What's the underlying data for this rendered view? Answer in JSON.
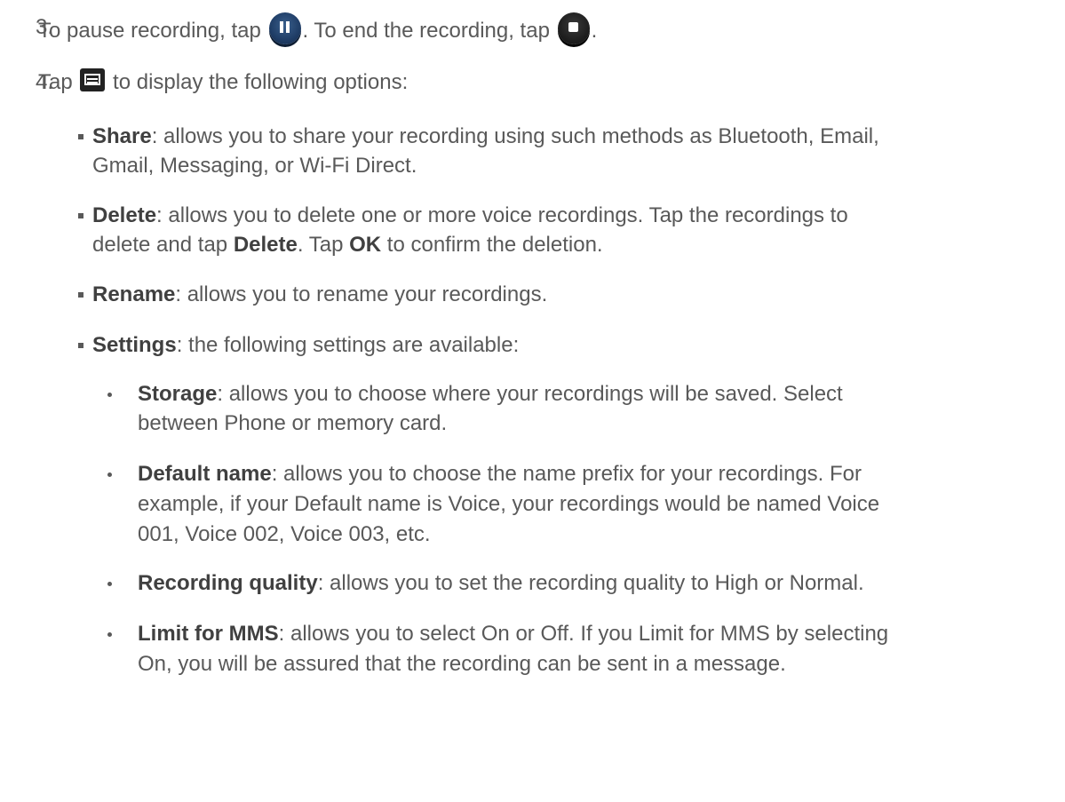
{
  "steps": [
    {
      "number": "3.",
      "t1": "To pause recording, tap",
      "t2": ". To end the recording, tap",
      "t3": ".",
      "icons": [
        "pause-icon",
        "stop-icon"
      ]
    },
    {
      "number": "4.",
      "t1": "Tap",
      "t2": "to display the following options:",
      "icons": [
        "menu-icon"
      ]
    }
  ],
  "options": [
    {
      "label": "Share",
      "line1": ": allows you to share your recording using such methods as Bluetooth, Email,",
      "line2": "Gmail, Messaging, or Wi-Fi Direct."
    },
    {
      "label": "Delete",
      "line1": ": allows you to delete one or more voice recordings. Tap the recordings to",
      "line2a": "delete and tap ",
      "line2b": "Delete",
      "line2c": ". Tap ",
      "line2d": "OK",
      "line2e": " to confirm the deletion."
    },
    {
      "label": "Rename",
      "line1": ": allows you to rename your recordings."
    },
    {
      "label": "Settings",
      "line1": ": the following settings are available:"
    }
  ],
  "settings": [
    {
      "label": "Storage",
      "line1": ": allows you to choose where your recordings will be saved. Select",
      "line2": "between Phone or memory card."
    },
    {
      "label": "Default name",
      "line1": ": allows you to choose the name prefix for your recordings. For",
      "line2": "example, if your Default name is Voice, your recordings would be named Voice",
      "line3": "001, Voice 002, Voice 003, etc."
    },
    {
      "label": "Recording quality",
      "line1": ": allows you to set the recording quality to High or Normal."
    },
    {
      "label": "Limit for MMS",
      "line1": ": allows you to select On or Off. If you Limit for MMS by selecting",
      "line2": "On, you will be assured that the recording can be sent in a message."
    }
  ]
}
